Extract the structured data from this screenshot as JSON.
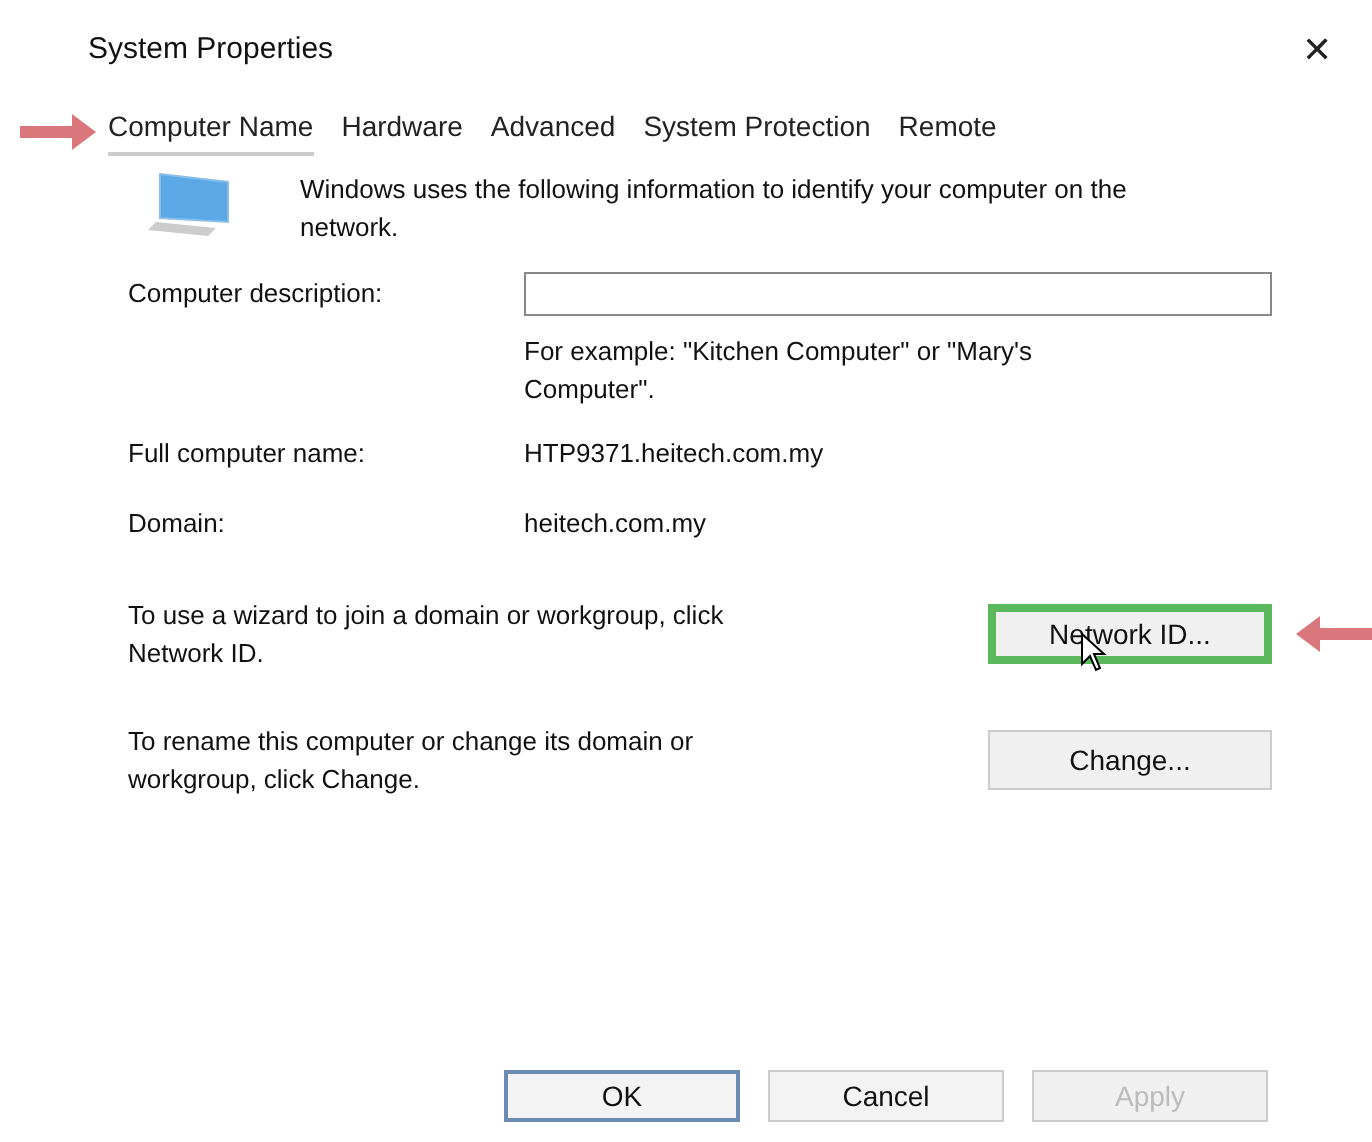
{
  "window": {
    "title": "System Properties",
    "close": "✕"
  },
  "tabs": [
    {
      "label": "Computer Name",
      "selected": true,
      "marked": true
    },
    {
      "label": "Hardware",
      "selected": false,
      "marked": false
    },
    {
      "label": "Advanced",
      "selected": false,
      "marked": false
    },
    {
      "label": "System Protection",
      "selected": false,
      "marked": false
    },
    {
      "label": "Remote",
      "selected": false,
      "marked": false
    }
  ],
  "intro": "Windows uses the following information to identify your computer on the network.",
  "description": {
    "label": "Computer description:",
    "hint": "For example: \"Kitchen Computer\" or \"Mary's Computer\"."
  },
  "fields": [
    {
      "label": "Full computer name:",
      "value": "HTP9371.heitech.com.my"
    },
    {
      "label": "Domain:",
      "value": "heitech.com.my"
    }
  ],
  "actions": [
    {
      "text": "To use a wizard to join a domain or workgroup, click Network ID.",
      "button": "Network ID...",
      "highlighted": true,
      "marked": true
    },
    {
      "text": "To rename this computer or change its domain or workgroup, click Change.",
      "button": "Change...",
      "highlighted": false,
      "marked": false
    }
  ],
  "buttons": [
    {
      "label": "OK",
      "default": true,
      "disabled": false
    },
    {
      "label": "Cancel",
      "default": false,
      "disabled": false
    },
    {
      "label": "Apply",
      "default": false,
      "disabled": true
    }
  ]
}
